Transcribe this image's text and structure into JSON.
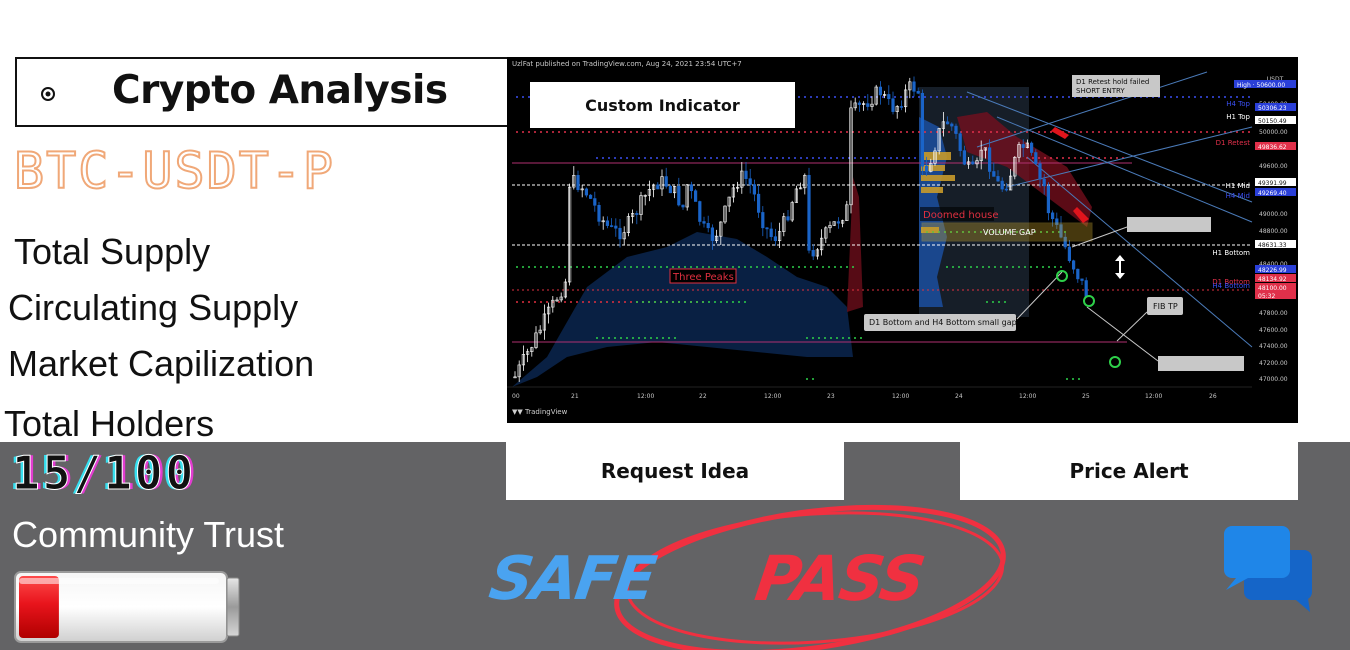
{
  "header": {
    "title": "Crypto Analysis",
    "ticker": "BTC-USDT-P"
  },
  "info": {
    "total_supply": "Total Supply",
    "circulating_supply": "Circulating Supply",
    "market_cap": "Market Capilization",
    "total_holders": "Total Holders"
  },
  "score": {
    "value": "15/100",
    "label": "Community Trust",
    "battery_level": 0.15,
    "battery_color": "#e8141c"
  },
  "chart": {
    "publisher": "UzlFat published on TradingView.com, Aug 24, 2021 23:54 UTC+7",
    "indicator_label": "Custom Indicator",
    "platform": "TradingView",
    "currency": "USDT",
    "x_ticks": [
      "00",
      "21",
      "12:00",
      "22",
      "12:00",
      "23",
      "12:00",
      "24",
      "12:00",
      "25",
      "12:00",
      "26"
    ],
    "y_ticks": [
      "50400.00",
      "50000.00",
      "49600.00",
      "49000.00",
      "48800.00",
      "48400.00",
      "47800.00",
      "47600.00",
      "47400.00",
      "47200.00",
      "47000.00"
    ],
    "price_tags": [
      {
        "text": "High · 50600.00",
        "color": "#2a3fd8"
      },
      {
        "text": "50306.23",
        "color": "#2a3fd8"
      },
      {
        "text": "50150.49",
        "color": "#ffffff"
      },
      {
        "text": "49836.62",
        "color": "#e0304a"
      },
      {
        "text": "49391.99",
        "color": "#ffffff"
      },
      {
        "text": "49269.40",
        "color": "#2a3fd8"
      },
      {
        "text": "48631.33",
        "color": "#ffffff"
      },
      {
        "text": "48226.99",
        "color": "#2a3fd8"
      },
      {
        "text": "48134.92",
        "color": "#e0304a"
      },
      {
        "text": "48100.00",
        "color": "#e0304a"
      },
      {
        "text": "05:32",
        "color": "#e0304a"
      }
    ],
    "level_labels": {
      "h4_top": "H4 Top",
      "h1_top": "H1 Top",
      "d1_retest": "D1 Retest",
      "h1_mid": "H1 Mid",
      "h4_mid": "H4 Mid",
      "h1_bottom": "H1 Bottom",
      "d1_bottom": "D1 Bottom",
      "h4_bottom": "H4 Bottom"
    },
    "annotations": {
      "d1_retest": "D1 Retest hold failed\nSHORT ENTRY",
      "doomed_house": "Doomed house",
      "volume_gap": "VOLUME GAP",
      "three_peaks": "Three Peaks",
      "d1_bottom_gap": "D1 Bottom and H4 Bottom small gap",
      "fib_tp": "FIB TP"
    }
  },
  "actions": {
    "request_idea": "Request Idea",
    "price_alert": "Price Alert"
  },
  "verdict": {
    "safe": "SAFE",
    "pass": "PASS"
  },
  "colors": {
    "band": "#636365",
    "ticker_outline": "#f0a878",
    "safe": "#4aa3f0",
    "pass": "#f03040",
    "chat_front": "#1f86e8",
    "chat_back": "#1565c8"
  },
  "icons": [
    "chat-icon",
    "target-icon",
    "battery-icon",
    "tradingview-logo"
  ]
}
